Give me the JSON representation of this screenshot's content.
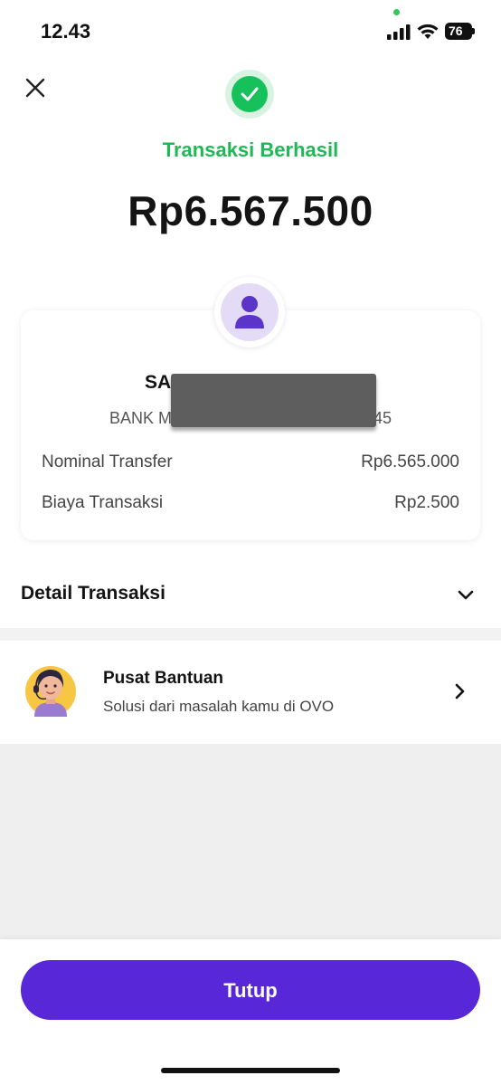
{
  "status_bar": {
    "time": "12.43",
    "battery": "76"
  },
  "header": {
    "status": "Transaksi Berhasil",
    "amount": "Rp6.567.500"
  },
  "recipient": {
    "name_visible": "SA",
    "bank_visible_start": "BANK M",
    "bank_visible_end": "45"
  },
  "summary": [
    {
      "label": "Nominal Transfer",
      "value": "Rp6.565.000"
    },
    {
      "label": "Biaya Transaksi",
      "value": "Rp2.500"
    }
  ],
  "detail": {
    "title": "Detail Transaksi"
  },
  "help": {
    "title": "Pusat Bantuan",
    "subtitle": "Solusi dari masalah kamu di OVO"
  },
  "footer": {
    "button_label": "Tutup"
  },
  "colors": {
    "success": "#1db954",
    "primary": "#5727d8"
  }
}
